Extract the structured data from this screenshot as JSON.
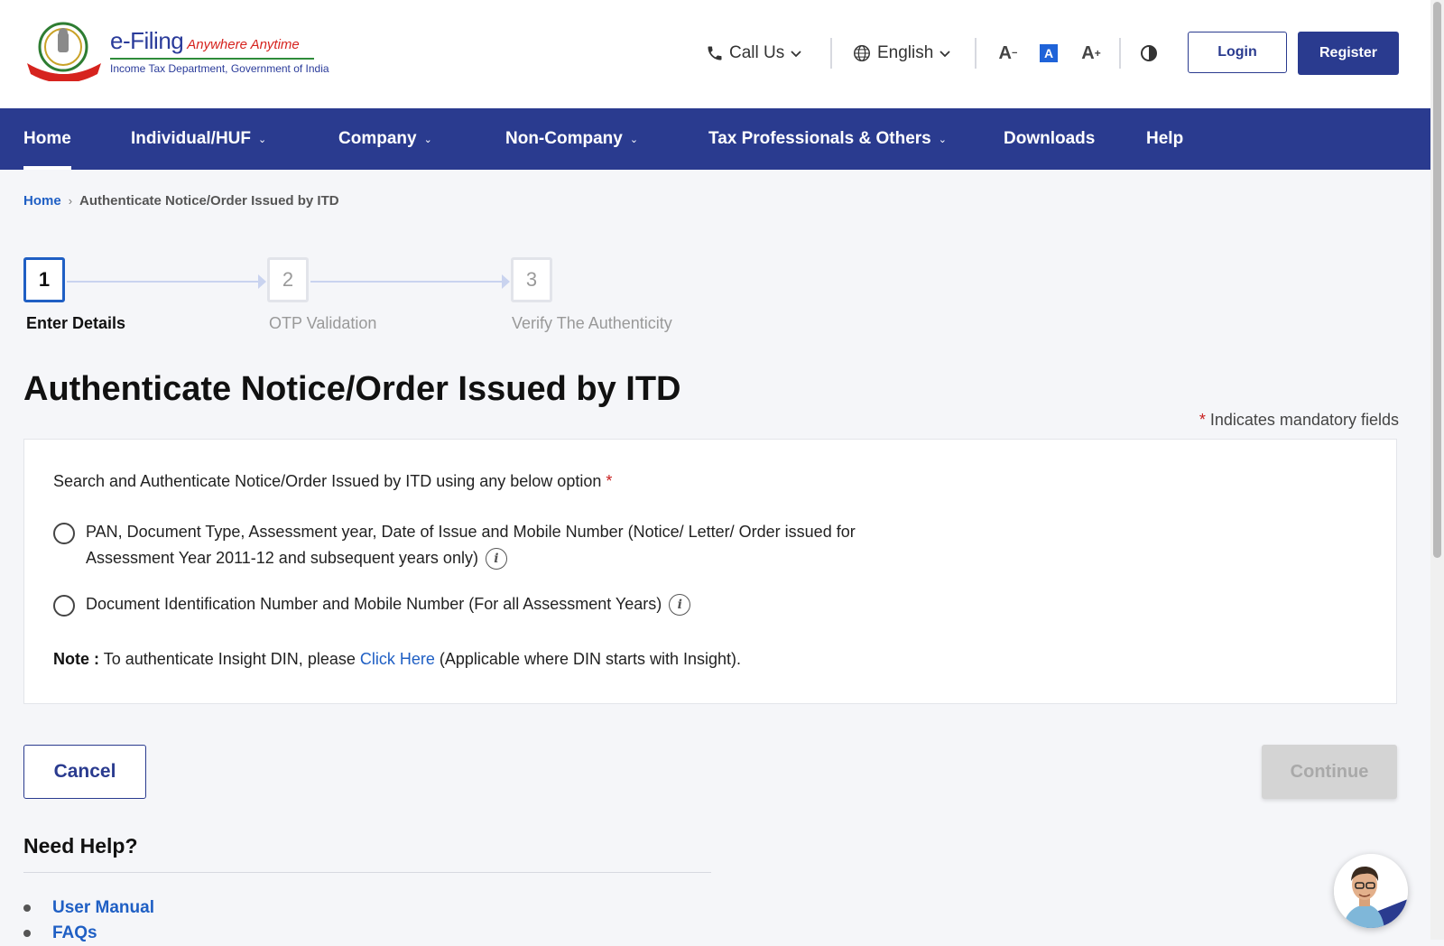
{
  "header": {
    "brand": {
      "name": "e-Filing",
      "tagline": "Anywhere Anytime",
      "subtitle": "Income Tax Department, Government of India"
    },
    "call_us": "Call Us",
    "language": "English",
    "font_buttons": {
      "decrease": "A",
      "default": "A",
      "increase": "A"
    },
    "login_label": "Login",
    "register_label": "Register"
  },
  "nav": {
    "items": [
      {
        "label": "Home"
      },
      {
        "label": "Individual/HUF"
      },
      {
        "label": "Company"
      },
      {
        "label": "Non-Company"
      },
      {
        "label": "Tax Professionals & Others"
      },
      {
        "label": "Downloads"
      },
      {
        "label": "Help"
      }
    ]
  },
  "breadcrumb": {
    "home": "Home",
    "current": "Authenticate Notice/Order Issued by ITD"
  },
  "stepper": {
    "steps": [
      {
        "number": "1",
        "label": "Enter Details"
      },
      {
        "number": "2",
        "label": "OTP Validation"
      },
      {
        "number": "3",
        "label": "Verify The Authenticity"
      }
    ]
  },
  "page": {
    "title": "Authenticate Notice/Order Issued by ITD",
    "mandatory_note": "Indicates mandatory fields",
    "question": "Search and Authenticate Notice/Order Issued by ITD using any below option",
    "options": [
      {
        "line1": "PAN, Document Type, Assessment year, Date of Issue and Mobile Number (Notice/ Letter/ Order issued for",
        "line2": "Assessment Year 2011-12 and subsequent years only)"
      },
      {
        "line1": "Document Identification Number and Mobile Number (For all Assessment Years)"
      }
    ],
    "note": {
      "label": "Note :",
      "prefix": "To authenticate Insight DIN, please",
      "link": "Click Here",
      "suffix": "(Applicable where DIN starts with Insight)."
    }
  },
  "actions": {
    "cancel": "Cancel",
    "continue": "Continue"
  },
  "help": {
    "title": "Need Help?",
    "links": [
      "User Manual",
      "FAQs"
    ]
  },
  "colors": {
    "primary": "#2a3b8f",
    "link": "#1f5fc4",
    "required": "#c81e1e"
  }
}
